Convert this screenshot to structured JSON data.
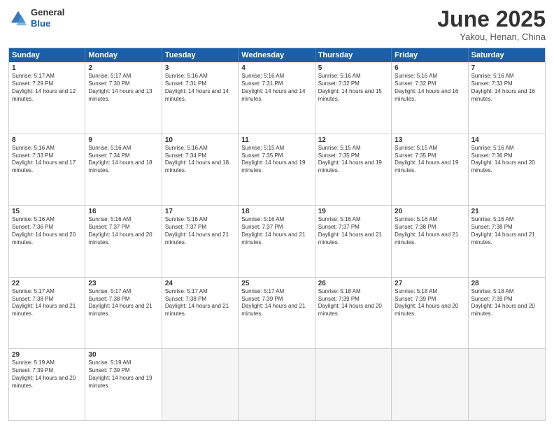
{
  "header": {
    "logo_general": "General",
    "logo_blue": "Blue",
    "title": "June 2025",
    "subtitle": "Yakou, Henan, China"
  },
  "calendar": {
    "days": [
      "Sunday",
      "Monday",
      "Tuesday",
      "Wednesday",
      "Thursday",
      "Friday",
      "Saturday"
    ],
    "rows": [
      [
        {
          "day": "1",
          "rise": "Sunrise: 5:17 AM",
          "set": "Sunset: 7:29 PM",
          "daylight": "Daylight: 14 hours and 12 minutes."
        },
        {
          "day": "2",
          "rise": "Sunrise: 5:17 AM",
          "set": "Sunset: 7:30 PM",
          "daylight": "Daylight: 14 hours and 13 minutes."
        },
        {
          "day": "3",
          "rise": "Sunrise: 5:16 AM",
          "set": "Sunset: 7:31 PM",
          "daylight": "Daylight: 14 hours and 14 minutes."
        },
        {
          "day": "4",
          "rise": "Sunrise: 5:16 AM",
          "set": "Sunset: 7:31 PM",
          "daylight": "Daylight: 14 hours and 14 minutes."
        },
        {
          "day": "5",
          "rise": "Sunrise: 5:16 AM",
          "set": "Sunset: 7:32 PM",
          "daylight": "Daylight: 14 hours and 15 minutes."
        },
        {
          "day": "6",
          "rise": "Sunrise: 5:16 AM",
          "set": "Sunset: 7:32 PM",
          "daylight": "Daylight: 14 hours and 16 minutes."
        },
        {
          "day": "7",
          "rise": "Sunrise: 5:16 AM",
          "set": "Sunset: 7:33 PM",
          "daylight": "Daylight: 14 hours and 16 minutes."
        }
      ],
      [
        {
          "day": "8",
          "rise": "Sunrise: 5:16 AM",
          "set": "Sunset: 7:33 PM",
          "daylight": "Daylight: 14 hours and 17 minutes."
        },
        {
          "day": "9",
          "rise": "Sunrise: 5:16 AM",
          "set": "Sunset: 7:34 PM",
          "daylight": "Daylight: 14 hours and 18 minutes."
        },
        {
          "day": "10",
          "rise": "Sunrise: 5:16 AM",
          "set": "Sunset: 7:34 PM",
          "daylight": "Daylight: 14 hours and 18 minutes."
        },
        {
          "day": "11",
          "rise": "Sunrise: 5:15 AM",
          "set": "Sunset: 7:35 PM",
          "daylight": "Daylight: 14 hours and 19 minutes."
        },
        {
          "day": "12",
          "rise": "Sunrise: 5:15 AM",
          "set": "Sunset: 7:35 PM",
          "daylight": "Daylight: 14 hours and 19 minutes."
        },
        {
          "day": "13",
          "rise": "Sunrise: 5:15 AM",
          "set": "Sunset: 7:35 PM",
          "daylight": "Daylight: 14 hours and 19 minutes."
        },
        {
          "day": "14",
          "rise": "Sunrise: 5:16 AM",
          "set": "Sunset: 7:36 PM",
          "daylight": "Daylight: 14 hours and 20 minutes."
        }
      ],
      [
        {
          "day": "15",
          "rise": "Sunrise: 5:16 AM",
          "set": "Sunset: 7:36 PM",
          "daylight": "Daylight: 14 hours and 20 minutes."
        },
        {
          "day": "16",
          "rise": "Sunrise: 5:16 AM",
          "set": "Sunset: 7:37 PM",
          "daylight": "Daylight: 14 hours and 20 minutes."
        },
        {
          "day": "17",
          "rise": "Sunrise: 5:16 AM",
          "set": "Sunset: 7:37 PM",
          "daylight": "Daylight: 14 hours and 21 minutes."
        },
        {
          "day": "18",
          "rise": "Sunrise: 5:16 AM",
          "set": "Sunset: 7:37 PM",
          "daylight": "Daylight: 14 hours and 21 minutes."
        },
        {
          "day": "19",
          "rise": "Sunrise: 5:16 AM",
          "set": "Sunset: 7:37 PM",
          "daylight": "Daylight: 14 hours and 21 minutes."
        },
        {
          "day": "20",
          "rise": "Sunrise: 5:16 AM",
          "set": "Sunset: 7:38 PM",
          "daylight": "Daylight: 14 hours and 21 minutes."
        },
        {
          "day": "21",
          "rise": "Sunrise: 5:16 AM",
          "set": "Sunset: 7:38 PM",
          "daylight": "Daylight: 14 hours and 21 minutes."
        }
      ],
      [
        {
          "day": "22",
          "rise": "Sunrise: 5:17 AM",
          "set": "Sunset: 7:38 PM",
          "daylight": "Daylight: 14 hours and 21 minutes."
        },
        {
          "day": "23",
          "rise": "Sunrise: 5:17 AM",
          "set": "Sunset: 7:38 PM",
          "daylight": "Daylight: 14 hours and 21 minutes."
        },
        {
          "day": "24",
          "rise": "Sunrise: 5:17 AM",
          "set": "Sunset: 7:38 PM",
          "daylight": "Daylight: 14 hours and 21 minutes."
        },
        {
          "day": "25",
          "rise": "Sunrise: 5:17 AM",
          "set": "Sunset: 7:39 PM",
          "daylight": "Daylight: 14 hours and 21 minutes."
        },
        {
          "day": "26",
          "rise": "Sunrise: 5:18 AM",
          "set": "Sunset: 7:39 PM",
          "daylight": "Daylight: 14 hours and 20 minutes."
        },
        {
          "day": "27",
          "rise": "Sunrise: 5:18 AM",
          "set": "Sunset: 7:39 PM",
          "daylight": "Daylight: 14 hours and 20 minutes."
        },
        {
          "day": "28",
          "rise": "Sunrise: 5:18 AM",
          "set": "Sunset: 7:39 PM",
          "daylight": "Daylight: 14 hours and 20 minutes."
        }
      ],
      [
        {
          "day": "29",
          "rise": "Sunrise: 5:19 AM",
          "set": "Sunset: 7:39 PM",
          "daylight": "Daylight: 14 hours and 20 minutes."
        },
        {
          "day": "30",
          "rise": "Sunrise: 5:19 AM",
          "set": "Sunset: 7:39 PM",
          "daylight": "Daylight: 14 hours and 19 minutes."
        },
        {
          "day": "",
          "rise": "",
          "set": "",
          "daylight": ""
        },
        {
          "day": "",
          "rise": "",
          "set": "",
          "daylight": ""
        },
        {
          "day": "",
          "rise": "",
          "set": "",
          "daylight": ""
        },
        {
          "day": "",
          "rise": "",
          "set": "",
          "daylight": ""
        },
        {
          "day": "",
          "rise": "",
          "set": "",
          "daylight": ""
        }
      ]
    ]
  }
}
